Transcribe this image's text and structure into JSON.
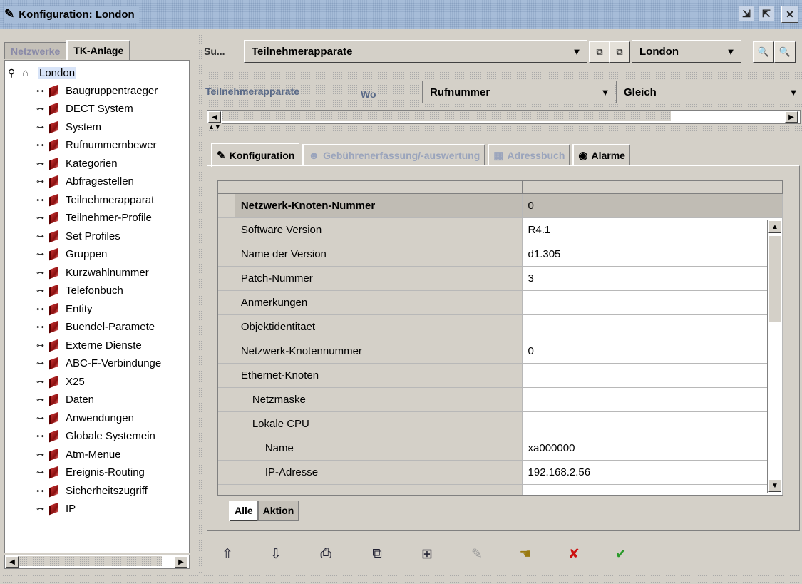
{
  "window": {
    "title": "Konfiguration: London",
    "controls": [
      "⇲",
      "⇱",
      "✕"
    ]
  },
  "left": {
    "tabs": [
      "Netzwerke",
      "TK-Anlage"
    ],
    "root": "London",
    "items": [
      "Baugruppentraeger",
      "DECT System",
      "System",
      "Rufnummernbewer",
      "Kategorien",
      "Abfragestellen",
      "Teilnehmerapparat",
      "Teilnehmer-Profile",
      "Set Profiles",
      "Gruppen",
      "Kurzwahlnummer",
      "Telefonbuch",
      "Entity",
      "Buendel-Paramete",
      "Externe Dienste",
      "ABC-F-Verbindunge",
      "X25",
      "Daten",
      "Anwendungen",
      "Globale Systemein",
      "Atm-Menue",
      "Ereignis-Routing",
      "Sicherheitszugriff",
      "IP"
    ]
  },
  "search": {
    "label": "Su...",
    "object_combo": "Teilnehmerapparate",
    "site_combo": "London",
    "filter_label": "Teilnehmerapparate",
    "where_label": "Wo",
    "field_combo": "Rufnummer",
    "op_combo": "Gleich"
  },
  "tabs": [
    {
      "label": "Konfiguration",
      "icon": "✎"
    },
    {
      "label": "Gebührenerfassung/-auswertung",
      "icon": "☻"
    },
    {
      "label": "Adressbuch",
      "icon": "▦"
    },
    {
      "label": "Alarme",
      "icon": "◉"
    }
  ],
  "grid": {
    "rows": [
      {
        "name": "Netzwerk-Knoten-Nummer",
        "value": "0"
      },
      {
        "name": "Software Version",
        "value": "R4.1"
      },
      {
        "name": "Name der Version",
        "value": "d1.305"
      },
      {
        "name": "Patch-Nummer",
        "value": "3"
      },
      {
        "name": "Anmerkungen",
        "value": ""
      },
      {
        "name": "Objektidentitaet",
        "value": ""
      },
      {
        "name": "Netzwerk-Knotennummer",
        "value": "0"
      },
      {
        "name": "Ethernet-Knoten",
        "value": ""
      },
      {
        "name": "Netzmaske",
        "value": ""
      },
      {
        "name": "Lokale CPU",
        "value": ""
      },
      {
        "name": "Name",
        "value": "xa000000"
      },
      {
        "name": "IP-Adresse",
        "value": "192.168.2.56"
      }
    ]
  },
  "bottom_tabs": [
    "Alle",
    "Aktion"
  ],
  "toolbar": {
    "icons": [
      "⇧",
      "⇩",
      "⎙",
      "⧉",
      "⊞",
      "✎",
      "☚",
      "✘",
      "✔"
    ],
    "colors": {
      "delete": "#cc1010",
      "apply": "#2a9a2a",
      "nav": "#223"
    }
  }
}
